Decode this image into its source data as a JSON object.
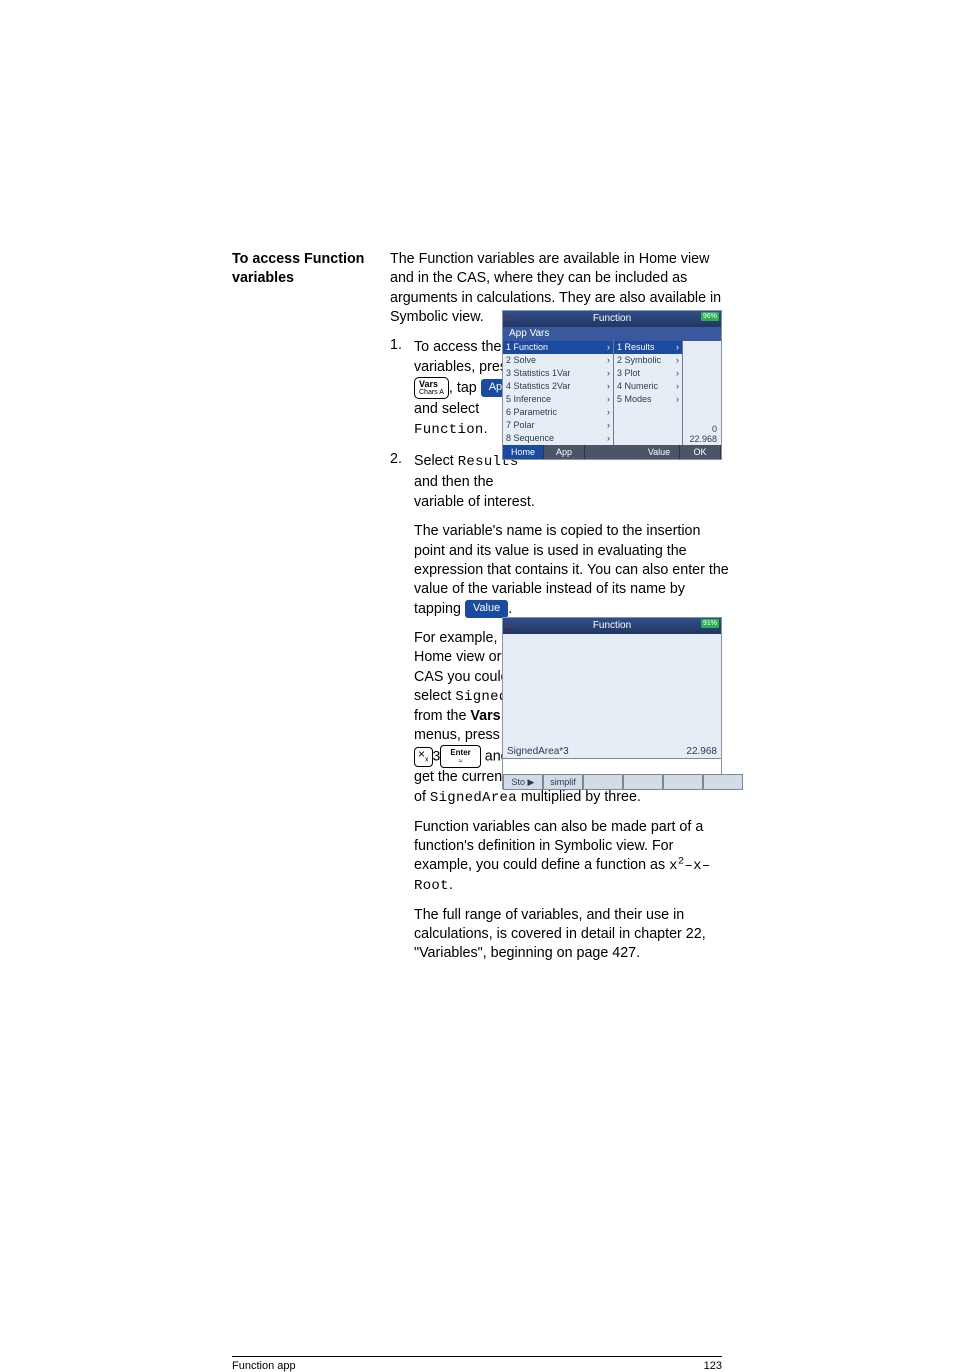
{
  "sidebar": {
    "heading1": "To access Function",
    "heading2": "variables"
  },
  "intro": "The Function variables are available in Home view and in the CAS, where they can be included as arguments in calculations. They are also available in Symbolic view.",
  "step1": {
    "num": "1.",
    "l1": "To access the",
    "l2": "variables, press",
    "key_vars_top": "Vars",
    "key_vars_sub": "Chars  A",
    "mid": ", tap ",
    "soft_app": "App",
    "l4": "and select",
    "code": "Function",
    "period": "."
  },
  "step2": {
    "num": "2.",
    "pre": "Select ",
    "code": "Results",
    "l2": "and then the",
    "l3": "variable of interest."
  },
  "postA": {
    "l1": "The variable's name is copied to the insertion point and its value is used in evaluating the expression that contains it. You can also enter the value of the variable instead of its name by tapping ",
    "btn": "Value",
    "tail": "."
  },
  "postB": {
    "l1": "For example, in",
    "l2": "Home view or the",
    "l3": "CAS you could",
    "l4a": "select ",
    "code": "SignedArea",
    "l5a": "from the ",
    "l5b": "Vars",
    "l6": "menus, press",
    "key_times": "×",
    "key_times_sub": "x",
    "three": "3",
    "key_enter_top": "Enter",
    "key_enter_sub": "≈",
    "l7": " and",
    "l8": "get the current value",
    "l9a": "of ",
    "l9code": "SignedArea",
    "l9b": " multiplied by three."
  },
  "paraC": {
    "t1": "Function variables can also be made part of a function's definition in Symbolic view. For example, you could define a function as ",
    "code": "x",
    "exp": "2",
    "code2": "–x–Root",
    "tail": "."
  },
  "paraD": "The full range of variables, and their use in calculations, is covered in detail in chapter 22, \"Variables\", beginning on page 427.",
  "screenshot1": {
    "title": "Function",
    "badge": "96%",
    "subtitle": "App Vars",
    "col1": [
      {
        "n": "1",
        "t": "Function"
      },
      {
        "n": "2",
        "t": "Solve"
      },
      {
        "n": "3",
        "t": "Statistics 1Var"
      },
      {
        "n": "4",
        "t": "Statistics 2Var"
      },
      {
        "n": "5",
        "t": "Inference"
      },
      {
        "n": "6",
        "t": "Parametric"
      },
      {
        "n": "7",
        "t": "Polar"
      },
      {
        "n": "8",
        "t": "Sequence"
      }
    ],
    "col2": [
      {
        "n": "1",
        "t": "Results"
      },
      {
        "n": "2",
        "t": "Symbolic"
      },
      {
        "n": "3",
        "t": "Plot"
      },
      {
        "n": "4",
        "t": "Numeric"
      },
      {
        "n": "5",
        "t": "Modes"
      }
    ],
    "rt_top": "0",
    "rt_bottom": "22.968",
    "softkeys": {
      "home": "Home",
      "app": "App",
      "value": "Value",
      "ok": "OK"
    }
  },
  "screenshot2": {
    "title": "Function",
    "badge": "91%",
    "hist_line": "SignedArea*3",
    "hist_val": "22.968",
    "soft": {
      "sto": "Sto ▶",
      "simp": "simplif"
    }
  },
  "footer": {
    "left": "Function app",
    "right": "123"
  }
}
